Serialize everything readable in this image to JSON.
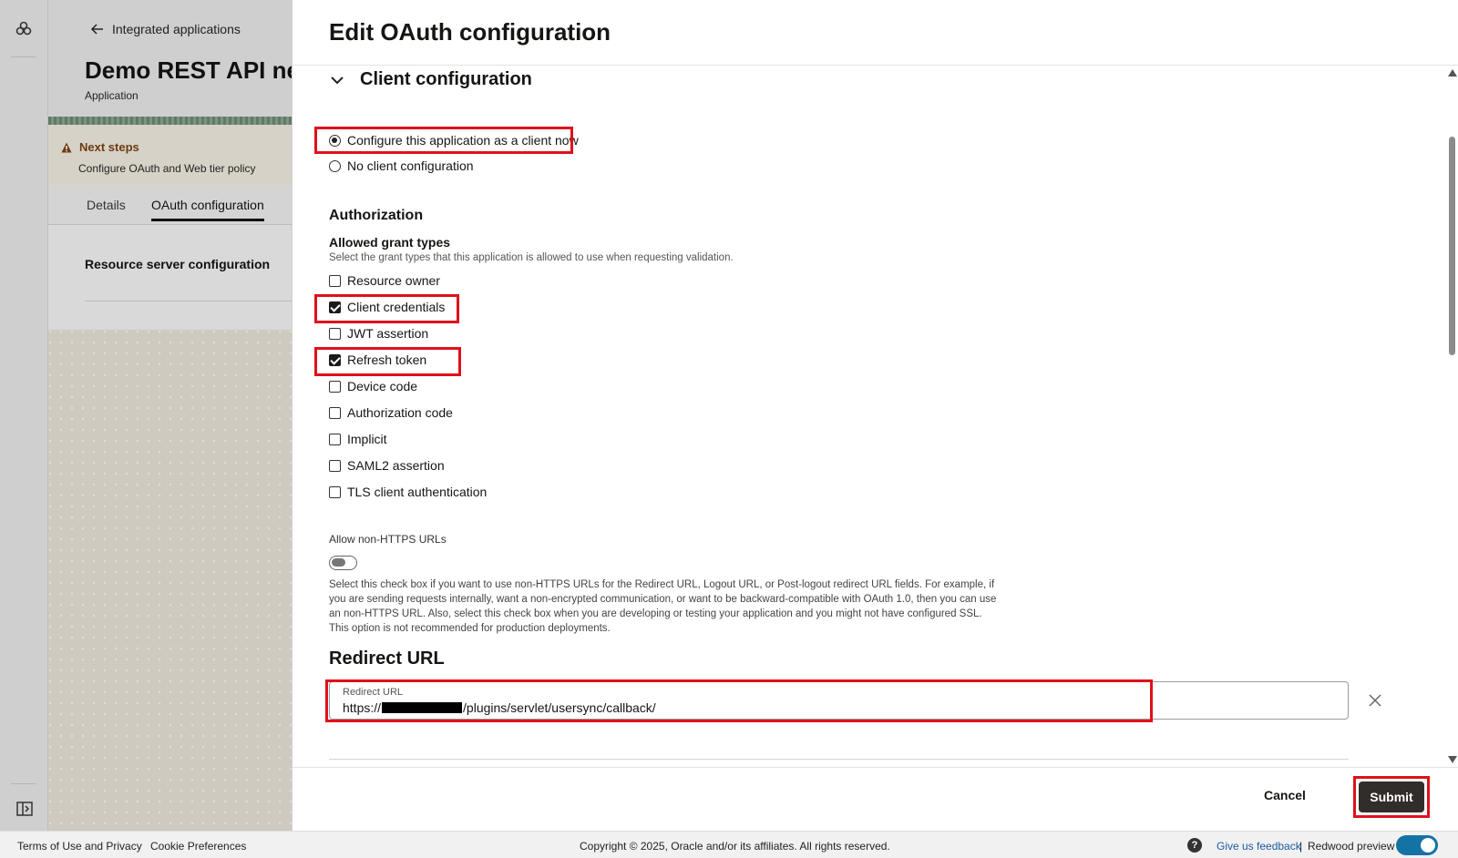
{
  "background": {
    "back_link": "Integrated applications",
    "app_title": "Demo REST API ne",
    "app_subtitle": "Application",
    "next_steps_title": "Next steps",
    "next_steps_text": "Configure OAuth and Web tier policy",
    "tabs": [
      {
        "label": "Details",
        "active": false
      },
      {
        "label": "OAuth configuration",
        "active": true
      }
    ],
    "section_label": "Resource server configuration"
  },
  "drawer": {
    "title": "Edit OAuth configuration",
    "section_title": "Client configuration",
    "client_options": [
      {
        "label": "Configure this application as a client now",
        "selected": true
      },
      {
        "label": "No client configuration",
        "selected": false
      }
    ],
    "authorization_heading": "Authorization",
    "grant_types_heading": "Allowed grant types",
    "grant_types_help": "Select the grant types that this application is allowed to use when requesting validation.",
    "grant_types": [
      {
        "label": "Resource owner",
        "checked": false
      },
      {
        "label": "Client credentials",
        "checked": true
      },
      {
        "label": "JWT assertion",
        "checked": false
      },
      {
        "label": "Refresh token",
        "checked": true
      },
      {
        "label": "Device code",
        "checked": false
      },
      {
        "label": "Authorization code",
        "checked": false
      },
      {
        "label": "Implicit",
        "checked": false
      },
      {
        "label": "SAML2 assertion",
        "checked": false
      },
      {
        "label": "TLS client authentication",
        "checked": false
      }
    ],
    "non_https_label": "Allow non-HTTPS URLs",
    "non_https_enabled": false,
    "non_https_help": "Select this check box if you want to use non-HTTPS URLs for the Redirect URL, Logout URL, or Post-logout redirect URL fields. For example, if you are sending requests internally, want a non-encrypted communication, or want to be backward-compatible with OAuth 1.0, then you can use an non-HTTPS URL. Also, select this check box when you are developing or testing your application and you might not have configured SSL. This option is not recommended for production deployments.",
    "redirect_heading": "Redirect URL",
    "redirect_field_label": "Redirect URL",
    "redirect_value_prefix": "https://",
    "redirect_value_suffix": "/plugins/servlet/usersync/callback/",
    "cancel_label": "Cancel",
    "submit_label": "Submit"
  },
  "footer": {
    "terms": "Terms of Use and Privacy",
    "cookies": "Cookie Preferences",
    "copyright": "Copyright © 2025, Oracle and/or its affiliates. All rights reserved.",
    "help_glyph": "?",
    "feedback": "Give us feedback",
    "separator": "|",
    "redwood_preview": "Redwood preview",
    "redwood_preview_enabled": true
  },
  "colors": {
    "highlight": "#e0101a",
    "primary_button": "#312d2a",
    "toggle_on": "#1473a5",
    "link": "#1d5aa6"
  },
  "icons": {
    "rail_logo": "oracle-logo-icon",
    "back": "arrow-left-icon",
    "warning": "warning-triangle-icon",
    "collapse": "chevron-down-icon",
    "clear": "close-icon",
    "panel": "panel-toggle-icon",
    "help": "help-circle-icon"
  }
}
